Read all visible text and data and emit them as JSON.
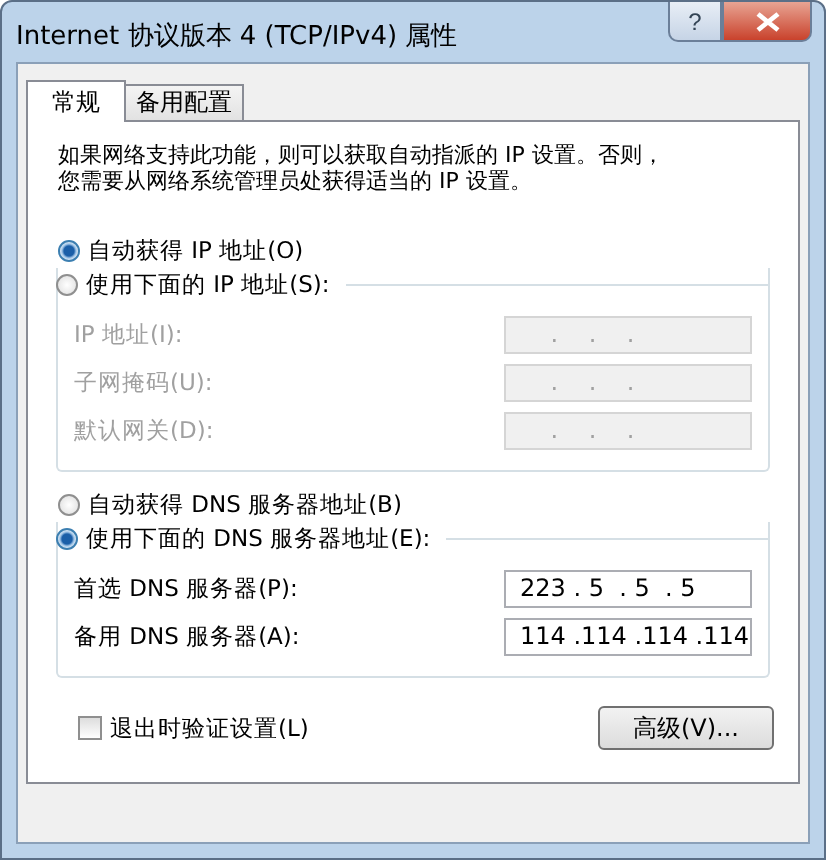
{
  "window": {
    "title": "Internet 协议版本 4 (TCP/IPv4) 属性",
    "help_button": "?"
  },
  "tabs": [
    {
      "label": "常规",
      "selected": true
    },
    {
      "label": "备用配置",
      "selected": false
    }
  ],
  "description": [
    "如果网络支持此功能，则可以获取自动指派的 IP 设置。否则，",
    "您需要从网络系统管理员处获得适当的 IP 设置。"
  ],
  "sections": [
    {
      "radios": [
        {
          "label": "自动获得 IP 地址(O)",
          "selected": true
        },
        {
          "label": "使用下面的 IP 地址(S):",
          "selected": false
        }
      ],
      "fields": [
        {
          "label": "IP 地址(I):",
          "value": "    .    .    .",
          "disabled": true
        },
        {
          "label": "子网掩码(U):",
          "value": "    .    .    .",
          "disabled": true
        },
        {
          "label": "默认网关(D):",
          "value": "    .    .    .",
          "disabled": true
        }
      ]
    },
    {
      "radios": [
        {
          "label": "自动获得 DNS 服务器地址(B)",
          "selected": false
        },
        {
          "label": "使用下面的 DNS 服务器地址(E):",
          "selected": true
        }
      ],
      "fields": [
        {
          "label": "首选 DNS 服务器(P):",
          "value": "223 . 5  . 5  . 5",
          "disabled": false
        },
        {
          "label": "备用 DNS 服务器(A):",
          "value": "114 .114 .114 .114",
          "disabled": false
        }
      ]
    }
  ],
  "validate_checkbox": {
    "label": "退出时验证设置(L)",
    "checked": false
  },
  "advanced_button": "高级(V)..."
}
